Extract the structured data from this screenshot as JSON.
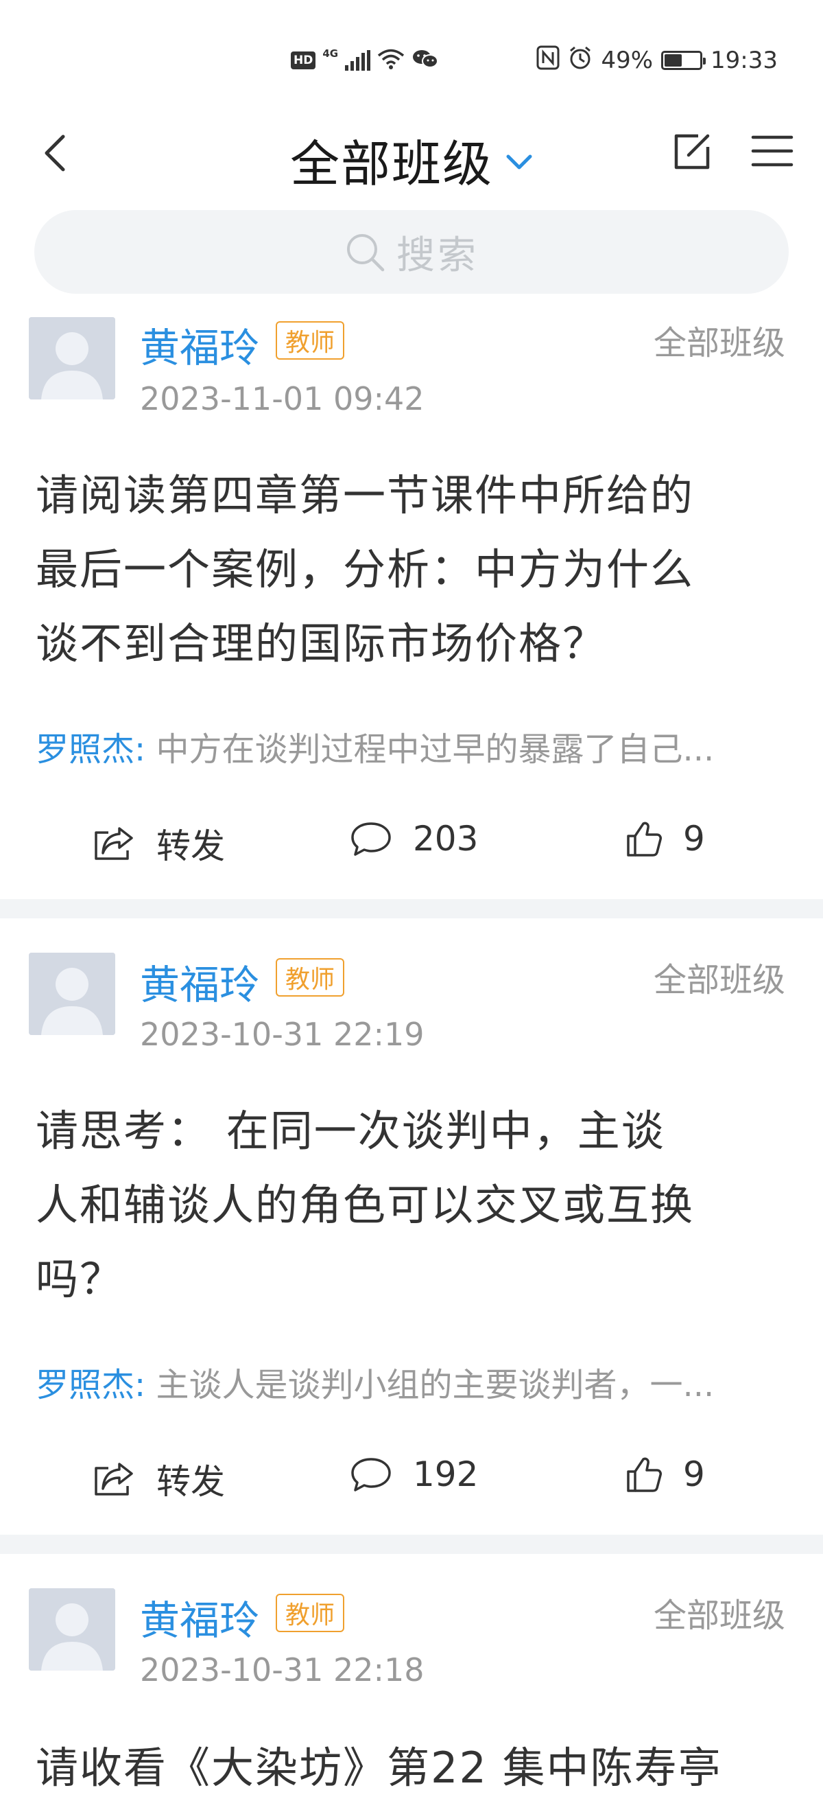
{
  "status_bar": {
    "hd": "HD",
    "network": "4G",
    "battery_level": 0.49,
    "battery_text": "49%",
    "time": "19:33",
    "icons": [
      "hd-icon",
      "signal-icon",
      "wifi-icon",
      "wechat-icon",
      "nfc-icon",
      "alarm-icon",
      "battery-icon"
    ]
  },
  "header": {
    "title": "全部班级",
    "icons": [
      "back-icon",
      "chevron-down-icon",
      "edit-icon",
      "menu-icon"
    ]
  },
  "search": {
    "placeholder": "搜索"
  },
  "posts": [
    {
      "author": "黄福玲",
      "role": "教师",
      "scope": "全部班级",
      "time": "2023-11-01 09:42",
      "lines": [
        "请阅读第四章第一节课件中所给的",
        "最后一个案例，分析：中方为什么",
        "谈不到合理的国际市场价格？"
      ],
      "reply_author": "罗照杰:",
      "reply_text": " 中方在谈判过程中过早的暴露了自己...",
      "share_label": "转发",
      "comments": "203",
      "likes": "9"
    },
    {
      "author": "黄福玲",
      "role": "教师",
      "scope": "全部班级",
      "time": "2023-10-31 22:19",
      "lines": [
        "请思考： 在同一次谈判中，主谈",
        "人和辅谈人的角色可以交叉或互换",
        "吗？"
      ],
      "reply_author": "罗照杰:",
      "reply_text": " 主谈人是谈判小组的主要谈判者，一...",
      "share_label": "转发",
      "comments": "192",
      "likes": "9"
    },
    {
      "author": "黄福玲",
      "role": "教师",
      "scope": "全部班级",
      "time": "2023-10-31 22:18",
      "lines": [
        "请收看《大染坊》第22 集中陈寿亭"
      ]
    }
  ]
}
